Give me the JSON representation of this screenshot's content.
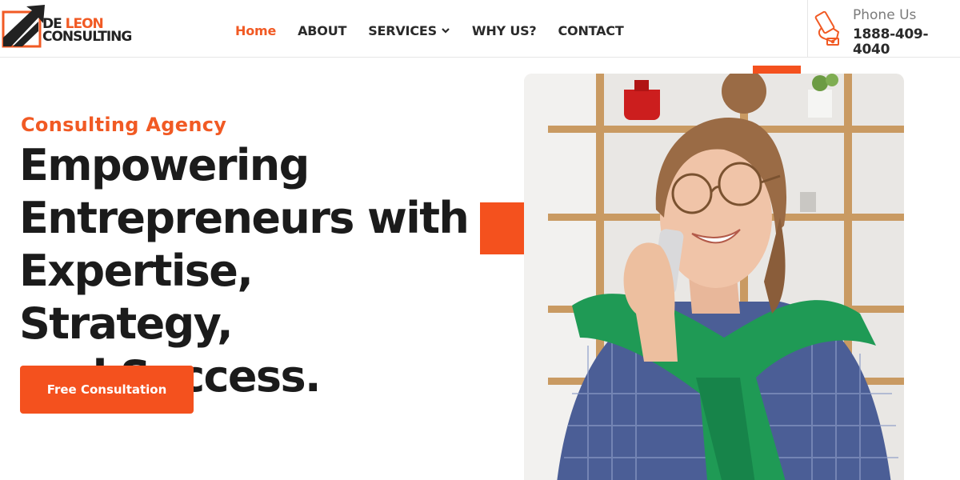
{
  "brand": {
    "logo_line1_a": "DE",
    "logo_line1_b": "LEON",
    "logo_line2": "CONSULTING",
    "accent_color": "#f4511e"
  },
  "nav": {
    "items": [
      {
        "label": "Home",
        "active": true
      },
      {
        "label": "ABOUT"
      },
      {
        "label": "SERVICES",
        "has_dropdown": true
      },
      {
        "label": "WHY US?"
      },
      {
        "label": "CONTACT"
      }
    ]
  },
  "contact": {
    "icon": "phone-hand-icon",
    "label": "Phone Us",
    "number": "1888-409-4040"
  },
  "hero": {
    "eyebrow": "Consulting Agency",
    "headline_lines": [
      "Empowering",
      "Entrepreneurs with",
      "Expertise, Strategy,",
      "and Success."
    ],
    "cta_label": "Free Consultation",
    "image": "woman-on-phone-photo"
  }
}
